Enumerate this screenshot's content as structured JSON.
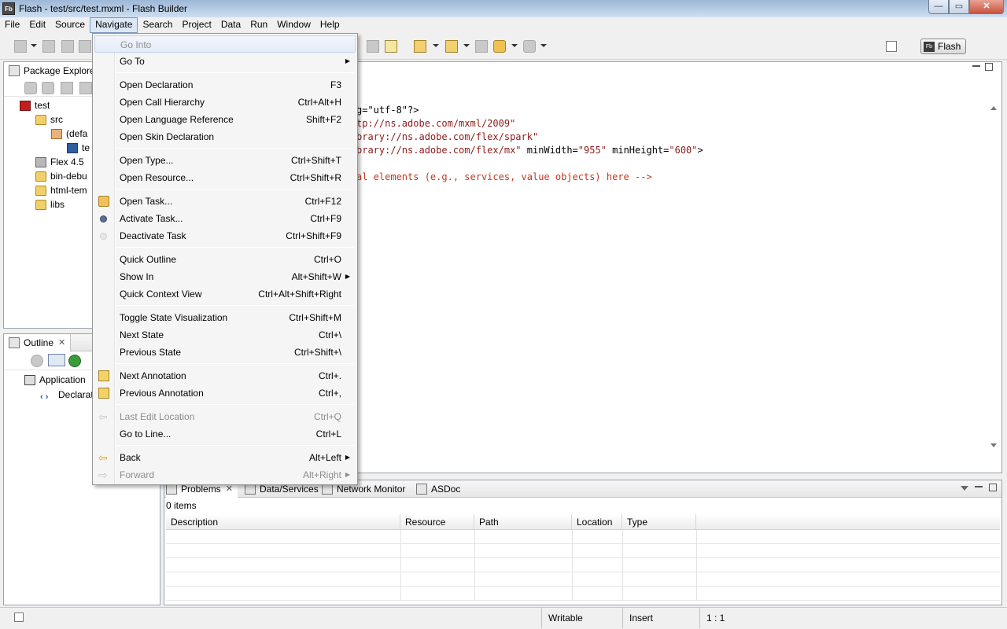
{
  "window": {
    "app_icon": "Fb",
    "title": "Flash - test/src/test.mxml - Flash Builder",
    "minimize": "—",
    "maximize": "▭",
    "close": "✕"
  },
  "menubar": [
    "File",
    "Edit",
    "Source",
    "Navigate",
    "Search",
    "Project",
    "Data",
    "Run",
    "Window",
    "Help"
  ],
  "perspective": {
    "icon": "Fb",
    "label": "Flash"
  },
  "package_explorer": {
    "tab": "Package Explorer",
    "tree": [
      {
        "label": "test",
        "icon": "flex-project-icon",
        "level": 0
      },
      {
        "label": "src",
        "icon": "source-folder-icon",
        "level": 1
      },
      {
        "label": "(defa",
        "icon": "package-icon",
        "level": 2
      },
      {
        "label": "te",
        "icon": "mxml-file-icon",
        "level": 3
      },
      {
        "label": "Flex 4.5",
        "icon": "library-icon",
        "level": 1
      },
      {
        "label": "bin-debu",
        "icon": "folder-icon",
        "level": 1
      },
      {
        "label": "html-tem",
        "icon": "folder-icon",
        "level": 1
      },
      {
        "label": "libs",
        "icon": "folder-icon",
        "level": 1
      }
    ]
  },
  "outline": {
    "tab": "Outline",
    "tree": [
      {
        "label": "Application",
        "icon": "application-icon"
      },
      {
        "label": "Declarat",
        "icon": "declarations-icon"
      }
    ]
  },
  "editor": {
    "lines": [
      {
        "parts": [
          {
            "t": "g=\"utf-8\"?>",
            "c": "text"
          }
        ]
      },
      {
        "parts": [
          {
            "t": "tp://ns.adobe.com/mxml/2009\"",
            "c": "str"
          }
        ]
      },
      {
        "parts": [
          {
            "t": "brary://ns.adobe.com/flex/spark\"",
            "c": "str"
          }
        ]
      },
      {
        "parts": [
          {
            "t": "brary://ns.adobe.com/flex/mx\"",
            "c": "str"
          },
          {
            "t": " minWidth=",
            "c": "text"
          },
          {
            "t": "\"955\"",
            "c": "str"
          },
          {
            "t": " minHeight=",
            "c": "text"
          },
          {
            "t": "\"600\"",
            "c": "str"
          },
          {
            "t": ">",
            "c": "text"
          }
        ]
      },
      {
        "parts": [
          {
            "t": "",
            "c": "text"
          }
        ]
      },
      {
        "parts": [
          {
            "t": "al elements (e.g., services, value objects) here -->",
            "c": "comment"
          }
        ]
      }
    ]
  },
  "navigate_menu": {
    "groups": [
      [
        {
          "label": "Go Into",
          "shortcut": "",
          "disabled": true,
          "highlight": true
        },
        {
          "label": "Go To",
          "shortcut": "",
          "submenu": true
        }
      ],
      [
        {
          "label": "Open Declaration",
          "shortcut": "F3"
        },
        {
          "label": "Open Call Hierarchy",
          "shortcut": "Ctrl+Alt+H"
        },
        {
          "label": "Open Language Reference",
          "shortcut": "Shift+F2"
        },
        {
          "label": "Open Skin Declaration",
          "shortcut": ""
        }
      ],
      [
        {
          "label": "Open Type...",
          "shortcut": "Ctrl+Shift+T"
        },
        {
          "label": "Open Resource...",
          "shortcut": "Ctrl+Shift+R"
        }
      ],
      [
        {
          "label": "Open Task...",
          "shortcut": "Ctrl+F12",
          "icon": "open-task-icon"
        },
        {
          "label": "Activate Task...",
          "shortcut": "Ctrl+F9",
          "icon": "activate-task-icon"
        },
        {
          "label": "Deactivate Task",
          "shortcut": "Ctrl+Shift+F9",
          "icon": "deactivate-task-icon"
        }
      ],
      [
        {
          "label": "Quick Outline",
          "shortcut": "Ctrl+O"
        },
        {
          "label": "Show In",
          "shortcut": "Alt+Shift+W",
          "submenu": true
        },
        {
          "label": "Quick Context View",
          "shortcut": "Ctrl+Alt+Shift+Right"
        }
      ],
      [
        {
          "label": "Toggle State Visualization",
          "shortcut": "Ctrl+Shift+M"
        },
        {
          "label": "Next State",
          "shortcut": "Ctrl+\\"
        },
        {
          "label": "Previous State",
          "shortcut": "Ctrl+Shift+\\"
        }
      ],
      [
        {
          "label": "Next Annotation",
          "shortcut": "Ctrl+.",
          "icon": "next-annotation-icon"
        },
        {
          "label": "Previous Annotation",
          "shortcut": "Ctrl+,",
          "icon": "previous-annotation-icon"
        }
      ],
      [
        {
          "label": "Last Edit Location",
          "shortcut": "Ctrl+Q",
          "disabled": true,
          "icon": "last-edit-icon"
        },
        {
          "label": "Go to Line...",
          "shortcut": "Ctrl+L"
        }
      ],
      [
        {
          "label": "Back",
          "shortcut": "Alt+Left",
          "submenu": true,
          "icon": "back-icon"
        },
        {
          "label": "Forward",
          "shortcut": "Alt+Right",
          "submenu": true,
          "disabled": true,
          "icon": "forward-icon"
        }
      ]
    ]
  },
  "problems": {
    "tabs": [
      "Problems",
      "Data/Services",
      "Network Monitor",
      "ASDoc"
    ],
    "count": "0 items",
    "columns": [
      "Description",
      "Resource",
      "Path",
      "Location",
      "Type"
    ]
  },
  "status": {
    "writable": "Writable",
    "mode": "Insert",
    "position": "1 : 1"
  }
}
